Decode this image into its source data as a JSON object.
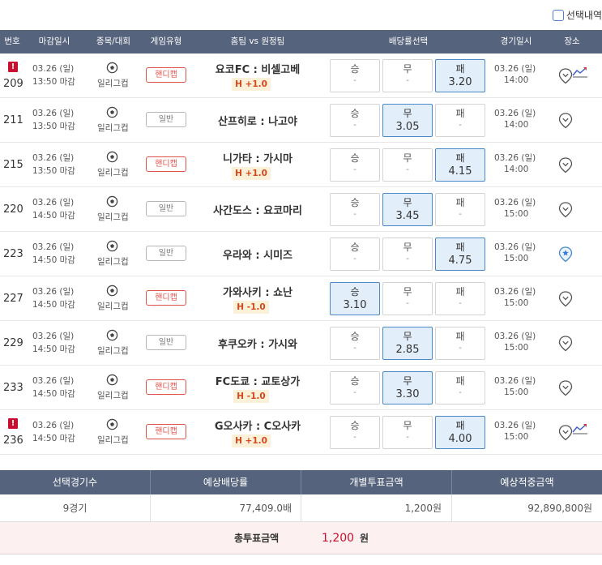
{
  "toolbar": {
    "selection_toggle_label": "선택내역"
  },
  "header": {
    "no": "번호",
    "deadline": "마감일시",
    "sport": "종목/대회",
    "type": "게임유형",
    "match": "홈팀 vs 원정팀",
    "odds": "배당률선택",
    "game_date": "경기일시",
    "venue": "장소"
  },
  "rows": [
    {
      "no": "209",
      "warn": true,
      "cut_date": "03.26 (일)",
      "cut_time": "13:50 마감",
      "league": "일리그컵",
      "type": "핸디캡",
      "handicap": true,
      "teams": "요코FC : 비셀고베",
      "hcap": "H +1.0",
      "win": "승",
      "win_odds": "-",
      "draw": "무",
      "draw_odds": "-",
      "lose": "패",
      "lose_odds": "3.20",
      "selected": "lose",
      "game_date": "03.26 (일)",
      "game_time": "14:00",
      "trend": true,
      "pin_active": false
    },
    {
      "no": "211",
      "warn": false,
      "cut_date": "03.26 (일)",
      "cut_time": "13:50 마감",
      "league": "일리그컵",
      "type": "일반",
      "handicap": false,
      "teams": "산프히로 : 나고야",
      "hcap": "",
      "win": "승",
      "win_odds": "-",
      "draw": "무",
      "draw_odds": "3.05",
      "lose": "패",
      "lose_odds": "-",
      "selected": "draw",
      "game_date": "03.26 (일)",
      "game_time": "14:00",
      "trend": false,
      "pin_active": false
    },
    {
      "no": "215",
      "warn": false,
      "cut_date": "03.26 (일)",
      "cut_time": "13:50 마감",
      "league": "일리그컵",
      "type": "핸디캡",
      "handicap": true,
      "teams": "니가타 : 가시마",
      "hcap": "H +1.0",
      "win": "승",
      "win_odds": "-",
      "draw": "무",
      "draw_odds": "-",
      "lose": "패",
      "lose_odds": "4.15",
      "selected": "lose",
      "game_date": "03.26 (일)",
      "game_time": "14:00",
      "trend": false,
      "pin_active": false
    },
    {
      "no": "220",
      "warn": false,
      "cut_date": "03.26 (일)",
      "cut_time": "14:50 마감",
      "league": "일리그컵",
      "type": "일반",
      "handicap": false,
      "teams": "사간도스 : 요코마리",
      "hcap": "",
      "win": "승",
      "win_odds": "-",
      "draw": "무",
      "draw_odds": "3.45",
      "lose": "패",
      "lose_odds": "-",
      "selected": "draw",
      "game_date": "03.26 (일)",
      "game_time": "15:00",
      "trend": false,
      "pin_active": false
    },
    {
      "no": "223",
      "warn": false,
      "cut_date": "03.26 (일)",
      "cut_time": "14:50 마감",
      "league": "일리그컵",
      "type": "일반",
      "handicap": false,
      "teams": "우라와 : 시미즈",
      "hcap": "",
      "win": "승",
      "win_odds": "-",
      "draw": "무",
      "draw_odds": "-",
      "lose": "패",
      "lose_odds": "4.75",
      "selected": "lose",
      "game_date": "03.26 (일)",
      "game_time": "15:00",
      "trend": false,
      "pin_active": true
    },
    {
      "no": "227",
      "warn": false,
      "cut_date": "03.26 (일)",
      "cut_time": "14:50 마감",
      "league": "일리그컵",
      "type": "핸디캡",
      "handicap": true,
      "teams": "가와사키 : 쇼난",
      "hcap": "H -1.0",
      "win": "승",
      "win_odds": "3.10",
      "draw": "무",
      "draw_odds": "-",
      "lose": "패",
      "lose_odds": "-",
      "selected": "win",
      "game_date": "03.26 (일)",
      "game_time": "15:00",
      "trend": false,
      "pin_active": false
    },
    {
      "no": "229",
      "warn": false,
      "cut_date": "03.26 (일)",
      "cut_time": "14:50 마감",
      "league": "일리그컵",
      "type": "일반",
      "handicap": false,
      "teams": "후쿠오카 : 가시와",
      "hcap": "",
      "win": "승",
      "win_odds": "-",
      "draw": "무",
      "draw_odds": "2.85",
      "lose": "패",
      "lose_odds": "-",
      "selected": "draw",
      "game_date": "03.26 (일)",
      "game_time": "15:00",
      "trend": false,
      "pin_active": false
    },
    {
      "no": "233",
      "warn": false,
      "cut_date": "03.26 (일)",
      "cut_time": "14:50 마감",
      "league": "일리그컵",
      "type": "핸디캡",
      "handicap": true,
      "teams": "FC도쿄 : 교토상가",
      "hcap": "H -1.0",
      "win": "승",
      "win_odds": "-",
      "draw": "무",
      "draw_odds": "3.30",
      "lose": "패",
      "lose_odds": "-",
      "selected": "draw",
      "game_date": "03.26 (일)",
      "game_time": "15:00",
      "trend": false,
      "pin_active": false
    },
    {
      "no": "236",
      "warn": true,
      "cut_date": "03.26 (일)",
      "cut_time": "14:50 마감",
      "league": "일리그컵",
      "type": "핸디캡",
      "handicap": true,
      "teams": "G오사카 : C오사카",
      "hcap": "H +1.0",
      "win": "승",
      "win_odds": "-",
      "draw": "무",
      "draw_odds": "-",
      "lose": "패",
      "lose_odds": "4.00",
      "selected": "lose",
      "game_date": "03.26 (일)",
      "game_time": "15:00",
      "trend": true,
      "pin_active": false
    }
  ],
  "summary": {
    "h_count": "선택경기수",
    "h_odds": "예상배당률",
    "h_stake": "개별투표금액",
    "h_payout": "예상적중금액",
    "count": "9경기",
    "odds": "77,409.0배",
    "stake": "1,200원",
    "payout": "92,890,800원",
    "total_label": "총투표금액",
    "total_value": "1,200",
    "total_unit": "원"
  },
  "colors": {
    "header_bg": "#56637c",
    "selected_bg": "#e2eef9",
    "selected_border": "#4a89c8",
    "handicap_red": "#e0534d",
    "warn_red": "#c8102e",
    "total_bg": "#fdf0f0"
  },
  "icons": {
    "warning": "warning-icon",
    "soccer": "soccer-ball-icon",
    "venue": "location-pin-icon",
    "trend": "trend-chart-icon"
  }
}
